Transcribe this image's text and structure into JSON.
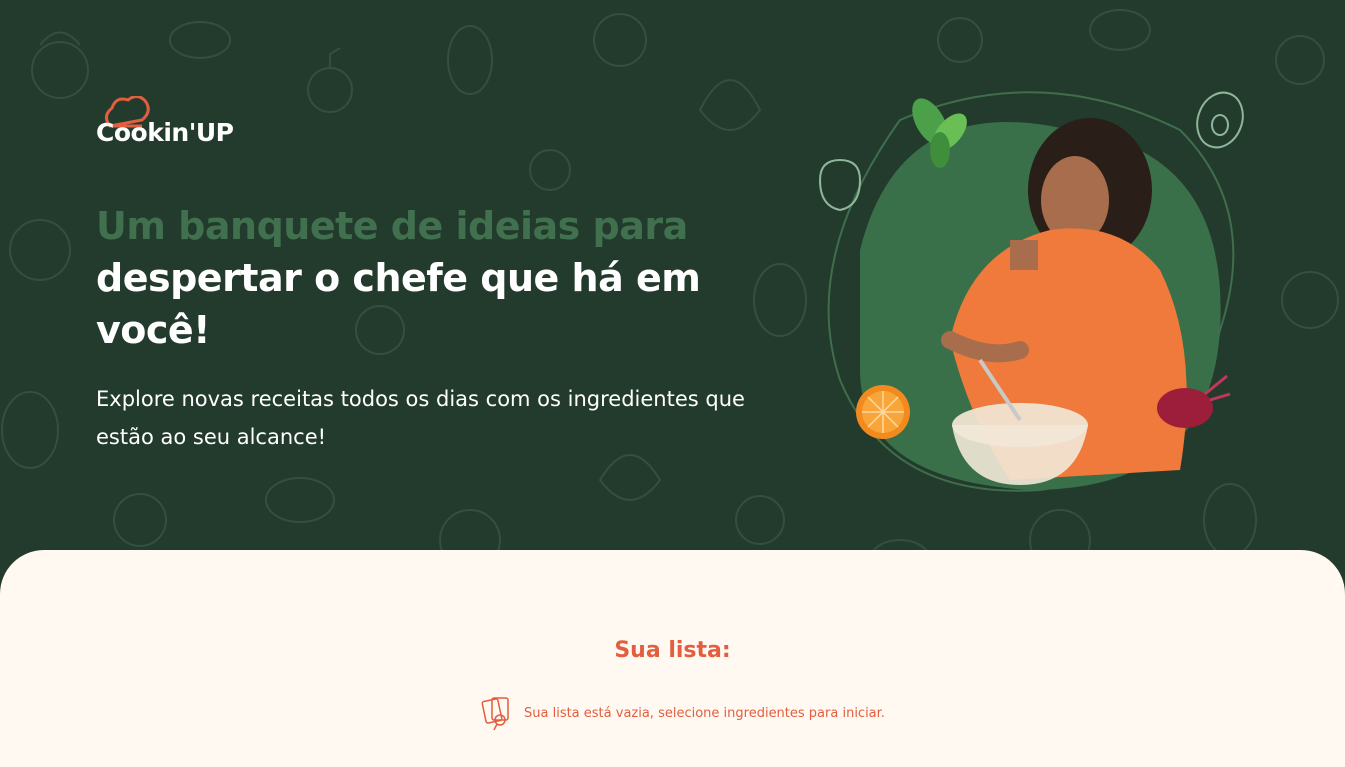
{
  "logo": {
    "text": "Cookin'UP"
  },
  "hero": {
    "headline_accent": "Um banquete de ideias para",
    "headline_main": "despertar o chefe que há em você!",
    "subtitle": "Explore novas receitas todos os dias com os ingredientes que estão ao seu alcance!"
  },
  "list": {
    "title": "Sua lista:",
    "empty_message": "Sua lista está vazia, selecione ingredientes para iniciar."
  },
  "colors": {
    "hero_bg": "#233B2D",
    "accent_green": "#41704F",
    "accent_orange": "#E25E3E",
    "page_bg": "#FFF9F2"
  },
  "icons": [
    "chef-hat-icon",
    "empty-list-icon",
    "basil-icon",
    "orange-slice-icon",
    "beet-icon",
    "pepper-icon",
    "avocado-icon"
  ]
}
